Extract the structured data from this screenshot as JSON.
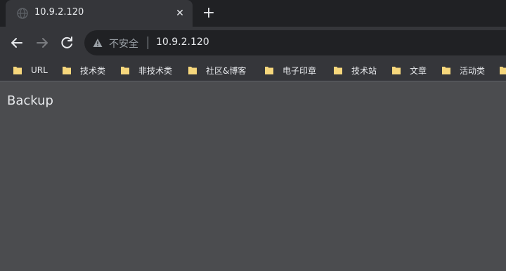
{
  "tab": {
    "title": "10.9.2.120",
    "close_glyph": "✕",
    "icon": "globe-icon"
  },
  "newtab": {
    "glyph": "+"
  },
  "toolbar": {
    "back_icon": "back-arrow-icon",
    "forward_icon": "forward-arrow-icon",
    "reload_icon": "reload-icon"
  },
  "omnibox": {
    "security_label": "不安全",
    "url": "10.9.2.120",
    "security_icon": "warning-triangle-icon"
  },
  "bookmarks": [
    {
      "label": "URL"
    },
    {
      "label": "技术类"
    },
    {
      "label": "非技术类"
    },
    {
      "label": "社区&博客"
    },
    {
      "label": "电子印章"
    },
    {
      "label": "技术站"
    },
    {
      "label": "文章"
    },
    {
      "label": "活动类"
    }
  ],
  "page": {
    "text": "Backup"
  },
  "colors": {
    "tabstrip": "#202124",
    "toolbar": "#35363a",
    "page_background": "#4b4c4f",
    "folder": "#f6d77c"
  }
}
